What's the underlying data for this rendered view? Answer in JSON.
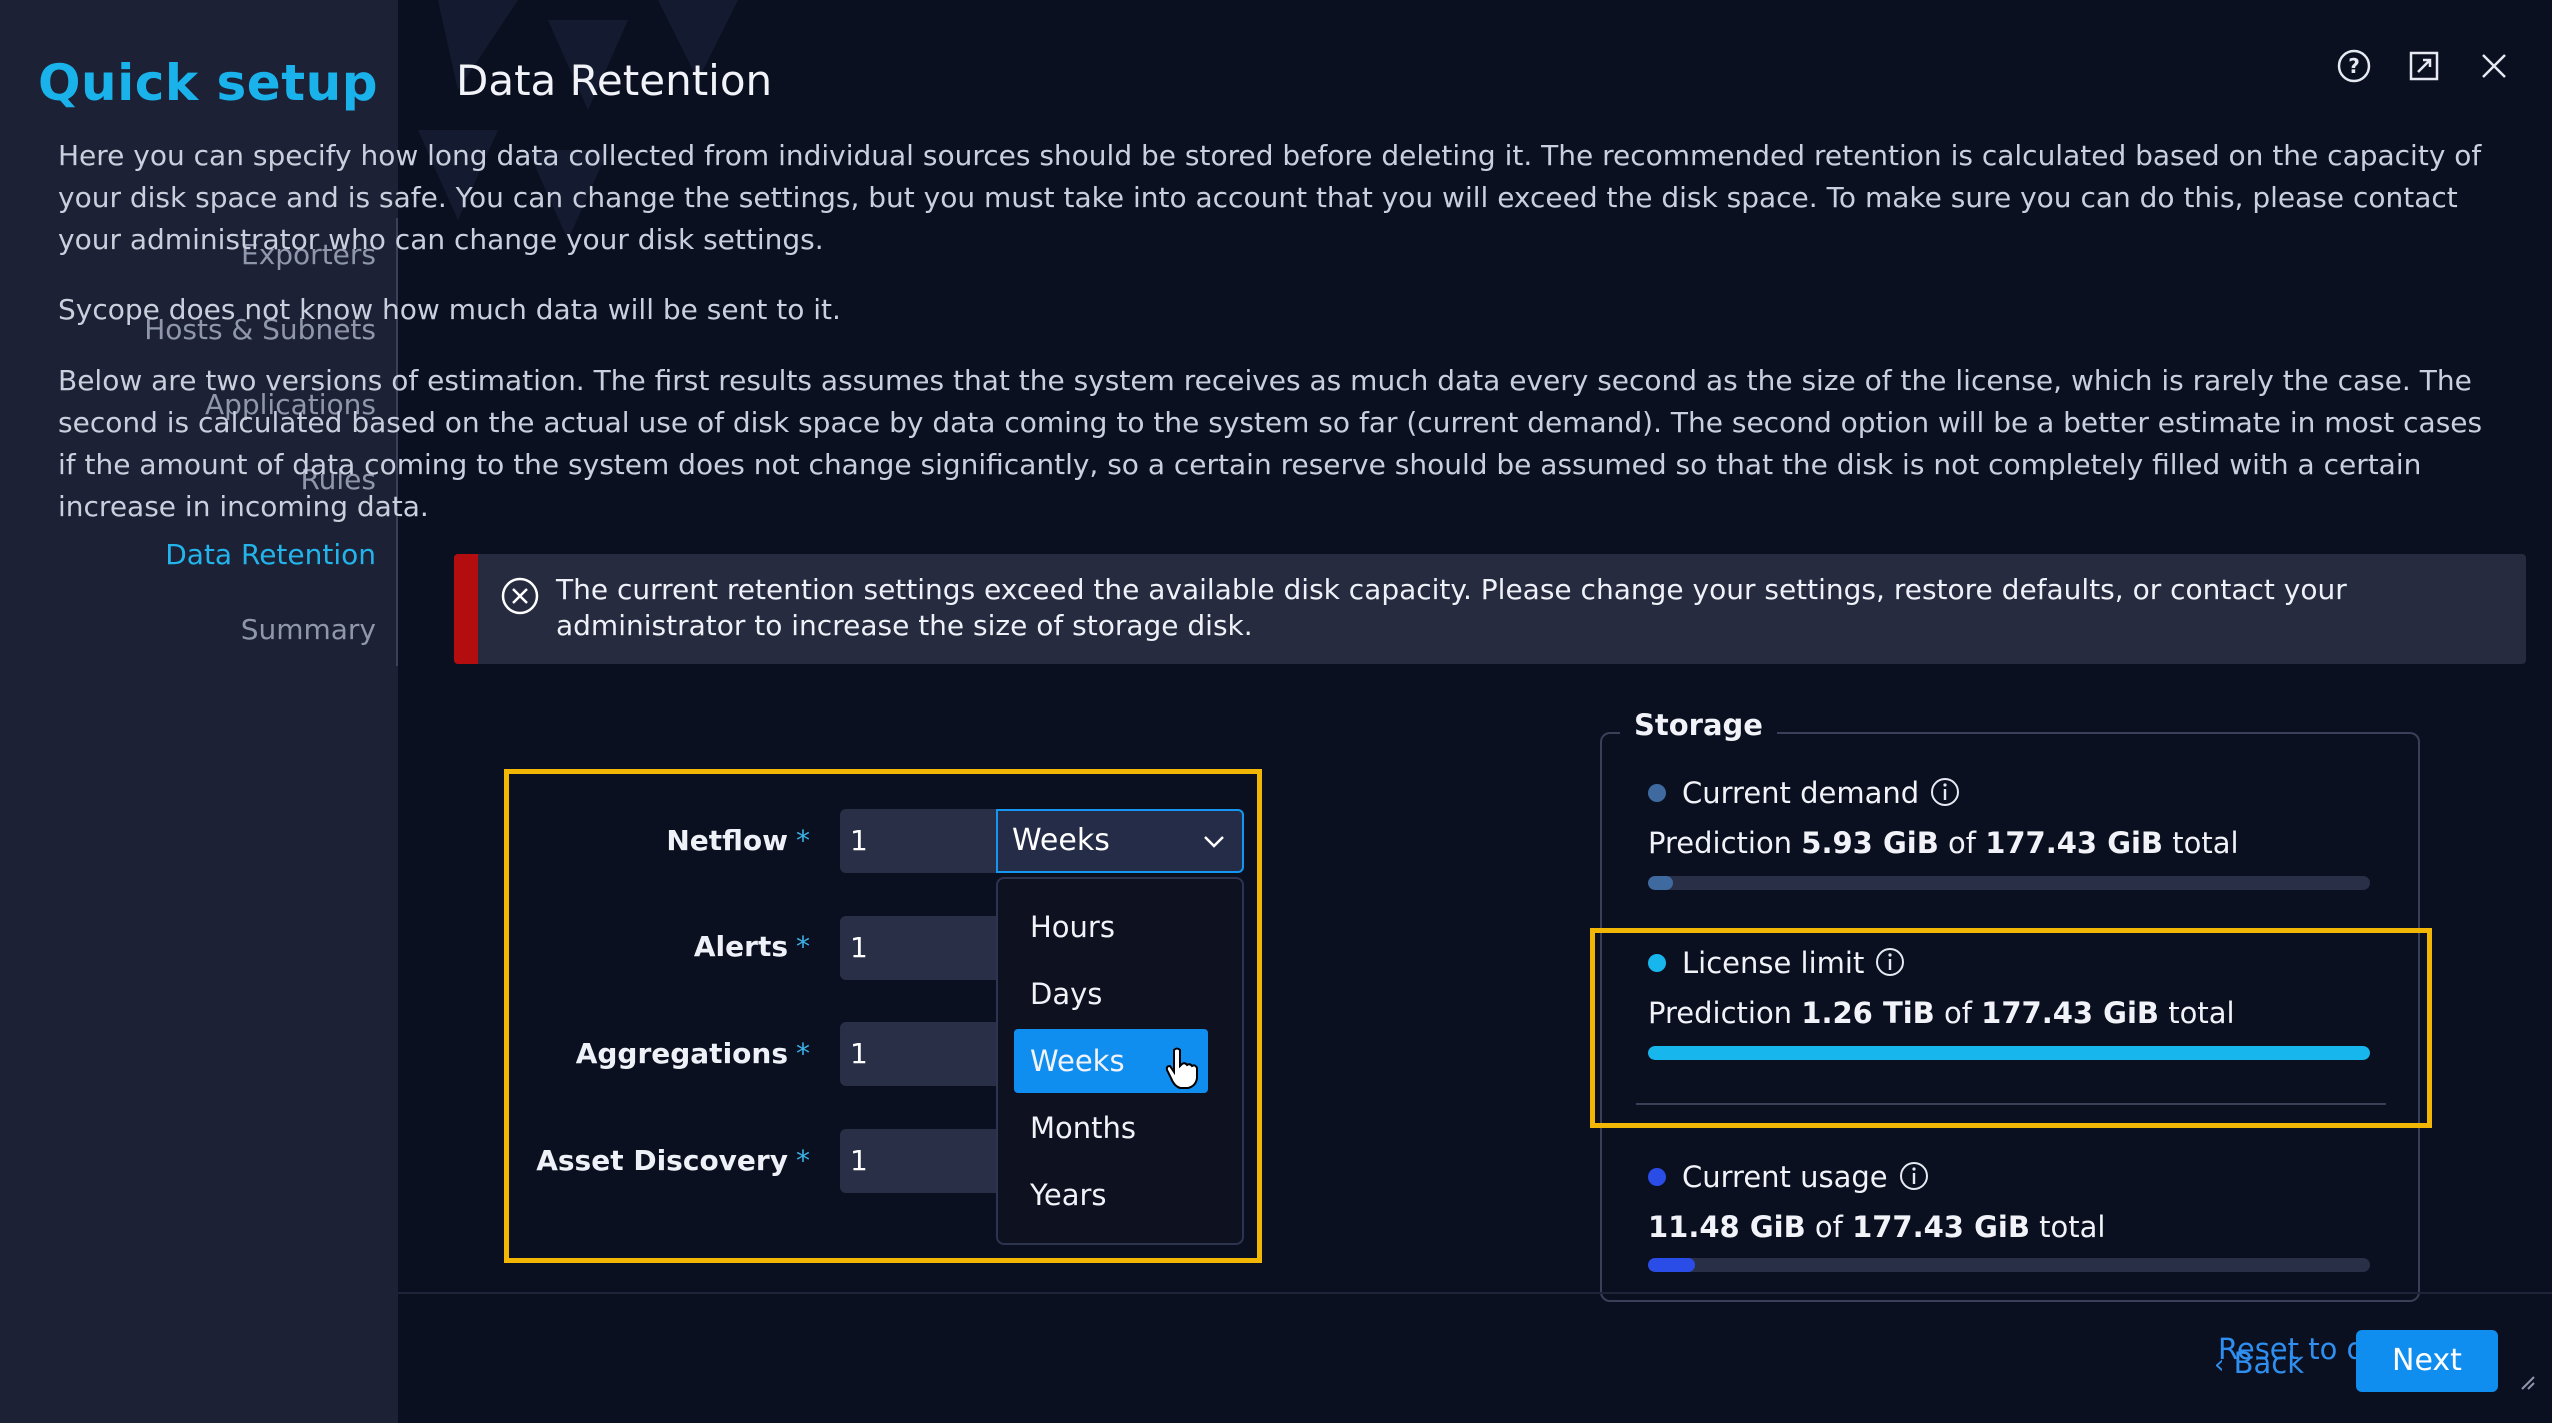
{
  "sidebar": {
    "title": "Quick setup",
    "items": [
      {
        "label": "Exporters",
        "active": false
      },
      {
        "label": "Hosts & Subnets",
        "active": false
      },
      {
        "label": "Applications",
        "active": false
      },
      {
        "label": "Rules",
        "active": false
      },
      {
        "label": "Data Retention",
        "active": true
      },
      {
        "label": "Summary",
        "active": false
      }
    ]
  },
  "header": {
    "title": "Data Retention",
    "icons": [
      "help-icon",
      "external-window-icon",
      "close-icon"
    ]
  },
  "content": {
    "paragraph1": "Here you can specify how long data collected from individual sources should be stored before deleting it. The recommended retention is calculated based on the capacity of your disk space and is safe. You can change the settings, but you must take into account that you will exceed the disk space. To make sure you can do this, please contact your administrator who can change your disk settings.",
    "paragraph2": "Sycope does not know how much data will be sent to it.",
    "paragraph3": "Below are two versions of estimation. The first results assumes that the system receives as much data every second as the size of the license, which is rarely the case. The second is calculated based on the actual use of disk space by data coming to the system so far (current demand). The second option will be a better estimate in most cases if the amount of data coming to the system does not change significantly, so a certain reserve should be assumed so that the disk is not completely filled with a certain increase in incoming data."
  },
  "error": {
    "text": "The current retention settings exceed the available disk capacity. Please change your settings, restore defaults, or contact your administrator to increase the size of storage disk.",
    "color": "#b30d0f"
  },
  "form": {
    "required_mark": "*",
    "fields": [
      {
        "label": "Netflow",
        "value": "1",
        "unit": "Weeks"
      },
      {
        "label": "Alerts",
        "value": "1"
      },
      {
        "label": "Aggregations",
        "value": "1"
      },
      {
        "label": "Asset Discovery",
        "value": "1"
      }
    ],
    "dropdown_options": [
      "Hours",
      "Days",
      "Weeks",
      "Months",
      "Years"
    ],
    "selected_option": "Weeks"
  },
  "storage": {
    "title": "Storage",
    "current_demand": {
      "label": "Current demand",
      "prefix": "Prediction",
      "used": "5.93 GiB",
      "of": "of",
      "total": "177.43 GiB",
      "suffix": "total",
      "fill_fraction": 0.034,
      "color": "#3f6aa0"
    },
    "license_limit": {
      "label": "License limit",
      "prefix": "Prediction",
      "used": "1.26 TiB",
      "of": "of",
      "total": "177.43 GiB",
      "suffix": "total",
      "fill_fraction": 1.0,
      "color": "#17b6ec"
    },
    "current_usage": {
      "label": "Current usage",
      "used": "11.48 GiB",
      "of": "of",
      "total": "177.43 GiB",
      "suffix": "total",
      "fill_fraction": 0.065,
      "color": "#2a4de8"
    }
  },
  "footer": {
    "reset_label": "Reset to de",
    "back_label": "Back",
    "next_label": "Next"
  },
  "colors": {
    "accent": "#1ab2ea",
    "highlight": "#f2b705",
    "button": "#0f8ef0"
  }
}
